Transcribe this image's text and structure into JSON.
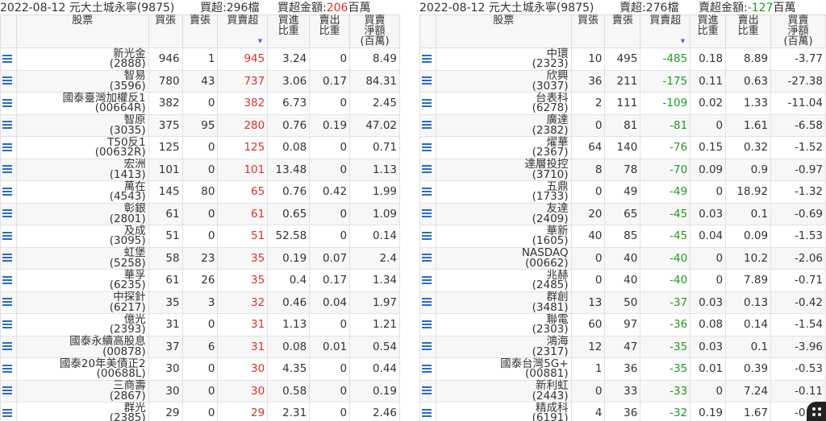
{
  "left": {
    "header": {
      "date_broker": "2022-08-12 元大土城永寧(9875)",
      "count_label": "買超:296檔",
      "amount_label": "買超金額:",
      "amount_value": "206",
      "amount_unit": "百萬"
    },
    "columns": [
      "股票",
      "買張",
      "賣張",
      "買賣超",
      "買進\n比重",
      "賣出\n比重",
      "買賣\n淨額\n(百萬)"
    ],
    "rows": [
      {
        "name": "新光金",
        "code": "(2888)",
        "buy": "946",
        "sell": "1",
        "net": "945",
        "buy_pct": "3.24",
        "sell_pct": "0",
        "amount": "8.49"
      },
      {
        "name": "智易",
        "code": "(3596)",
        "buy": "780",
        "sell": "43",
        "net": "737",
        "buy_pct": "3.06",
        "sell_pct": "0.17",
        "amount": "84.31"
      },
      {
        "name": "國泰臺灣加權反1",
        "code": "(00664R)",
        "buy": "382",
        "sell": "0",
        "net": "382",
        "buy_pct": "6.73",
        "sell_pct": "0",
        "amount": "2.45"
      },
      {
        "name": "智原",
        "code": "(3035)",
        "buy": "375",
        "sell": "95",
        "net": "280",
        "buy_pct": "0.76",
        "sell_pct": "0.19",
        "amount": "47.02"
      },
      {
        "name": "T50反1",
        "code": "(00632R)",
        "buy": "125",
        "sell": "0",
        "net": "125",
        "buy_pct": "0.08",
        "sell_pct": "0",
        "amount": "0.71"
      },
      {
        "name": "宏洲",
        "code": "(1413)",
        "buy": "101",
        "sell": "0",
        "net": "101",
        "buy_pct": "13.48",
        "sell_pct": "0",
        "amount": "1.13"
      },
      {
        "name": "萬在",
        "code": "(4543)",
        "buy": "145",
        "sell": "80",
        "net": "65",
        "buy_pct": "0.76",
        "sell_pct": "0.42",
        "amount": "1.99"
      },
      {
        "name": "彰銀",
        "code": "(2801)",
        "buy": "61",
        "sell": "0",
        "net": "61",
        "buy_pct": "0.65",
        "sell_pct": "0",
        "amount": "1.09"
      },
      {
        "name": "及成",
        "code": "(3095)",
        "buy": "51",
        "sell": "0",
        "net": "51",
        "buy_pct": "52.58",
        "sell_pct": "0",
        "amount": "0.14"
      },
      {
        "name": "虹堡",
        "code": "(5258)",
        "buy": "58",
        "sell": "23",
        "net": "35",
        "buy_pct": "0.19",
        "sell_pct": "0.07",
        "amount": "2.4"
      },
      {
        "name": "華孚",
        "code": "(6235)",
        "buy": "61",
        "sell": "26",
        "net": "35",
        "buy_pct": "0.4",
        "sell_pct": "0.17",
        "amount": "1.34"
      },
      {
        "name": "中探針",
        "code": "(6217)",
        "buy": "35",
        "sell": "3",
        "net": "32",
        "buy_pct": "0.46",
        "sell_pct": "0.04",
        "amount": "1.97"
      },
      {
        "name": "億光",
        "code": "(2393)",
        "buy": "31",
        "sell": "0",
        "net": "31",
        "buy_pct": "1.13",
        "sell_pct": "0",
        "amount": "1.21"
      },
      {
        "name": "國泰永續高股息",
        "code": "(00878)",
        "buy": "37",
        "sell": "6",
        "net": "31",
        "buy_pct": "0.08",
        "sell_pct": "0.01",
        "amount": "0.54"
      },
      {
        "name": "國泰20年美債正2",
        "code": "(00688L)",
        "buy": "30",
        "sell": "0",
        "net": "30",
        "buy_pct": "4.35",
        "sell_pct": "0",
        "amount": "0.44"
      },
      {
        "name": "三商壽",
        "code": "(2867)",
        "buy": "30",
        "sell": "0",
        "net": "30",
        "buy_pct": "0.58",
        "sell_pct": "0",
        "amount": "0.19"
      },
      {
        "name": "群光",
        "code": "(2385)",
        "buy": "29",
        "sell": "0",
        "net": "29",
        "buy_pct": "2.31",
        "sell_pct": "0",
        "amount": "2.46"
      }
    ]
  },
  "right": {
    "header": {
      "date_broker": "2022-08-12 元大土城永寧(9875)",
      "count_label": "賣超:276檔",
      "amount_label": "賣超金額:",
      "amount_value": "-127",
      "amount_unit": "百萬"
    },
    "columns": [
      "股票",
      "買張",
      "賣張",
      "買賣超",
      "買進\n比重",
      "賣出\n比重",
      "買賣\n淨額\n(百萬)"
    ],
    "rows": [
      {
        "name": "中環",
        "code": "(2323)",
        "buy": "10",
        "sell": "495",
        "net": "-485",
        "buy_pct": "0.18",
        "sell_pct": "8.89",
        "amount": "-3.77"
      },
      {
        "name": "欣興",
        "code": "(3037)",
        "buy": "36",
        "sell": "211",
        "net": "-175",
        "buy_pct": "0.11",
        "sell_pct": "0.63",
        "amount": "-27.38"
      },
      {
        "name": "台表科",
        "code": "(6278)",
        "buy": "2",
        "sell": "111",
        "net": "-109",
        "buy_pct": "0.02",
        "sell_pct": "1.33",
        "amount": "-11.04"
      },
      {
        "name": "廣達",
        "code": "(2382)",
        "buy": "0",
        "sell": "81",
        "net": "-81",
        "buy_pct": "0",
        "sell_pct": "1.61",
        "amount": "-6.58"
      },
      {
        "name": "燿華",
        "code": "(2367)",
        "buy": "64",
        "sell": "140",
        "net": "-76",
        "buy_pct": "0.15",
        "sell_pct": "0.32",
        "amount": "-1.52"
      },
      {
        "name": "達層投控",
        "code": "(3710)",
        "buy": "8",
        "sell": "78",
        "net": "-70",
        "buy_pct": "0.09",
        "sell_pct": "0.9",
        "amount": "-0.97"
      },
      {
        "name": "五鼎",
        "code": "(1733)",
        "buy": "0",
        "sell": "49",
        "net": "-49",
        "buy_pct": "0",
        "sell_pct": "18.92",
        "amount": "-1.32"
      },
      {
        "name": "友達",
        "code": "(2409)",
        "buy": "20",
        "sell": "65",
        "net": "-45",
        "buy_pct": "0.03",
        "sell_pct": "0.1",
        "amount": "-0.69"
      },
      {
        "name": "華新",
        "code": "(1605)",
        "buy": "40",
        "sell": "85",
        "net": "-45",
        "buy_pct": "0.04",
        "sell_pct": "0.09",
        "amount": "-1.53"
      },
      {
        "name": "NASDAQ",
        "code": "(00662)",
        "buy": "0",
        "sell": "40",
        "net": "-40",
        "buy_pct": "0",
        "sell_pct": "10.2",
        "amount": "-2.06"
      },
      {
        "name": "兆赫",
        "code": "(2485)",
        "buy": "0",
        "sell": "40",
        "net": "-40",
        "buy_pct": "0",
        "sell_pct": "7.89",
        "amount": "-0.71"
      },
      {
        "name": "群創",
        "code": "(3481)",
        "buy": "13",
        "sell": "50",
        "net": "-37",
        "buy_pct": "0.03",
        "sell_pct": "0.13",
        "amount": "-0.42"
      },
      {
        "name": "聯電",
        "code": "(2303)",
        "buy": "60",
        "sell": "97",
        "net": "-36",
        "buy_pct": "0.08",
        "sell_pct": "0.14",
        "amount": "-1.54"
      },
      {
        "name": "鴻海",
        "code": "(2317)",
        "buy": "12",
        "sell": "47",
        "net": "-35",
        "buy_pct": "0.03",
        "sell_pct": "0.1",
        "amount": "-3.96"
      },
      {
        "name": "國泰台灣5G+",
        "code": "(00881)",
        "buy": "1",
        "sell": "36",
        "net": "-35",
        "buy_pct": "0.01",
        "sell_pct": "0.39",
        "amount": "-0.53"
      },
      {
        "name": "新利虹",
        "code": "(2443)",
        "buy": "0",
        "sell": "33",
        "net": "-33",
        "buy_pct": "0",
        "sell_pct": "7.24",
        "amount": "-0.11"
      },
      {
        "name": "精成科",
        "code": "(6191)",
        "buy": "4",
        "sell": "36",
        "net": "-32",
        "buy_pct": "0.19",
        "sell_pct": "1.67",
        "amount": "-0.11"
      }
    ]
  },
  "colors": {
    "positive": "#e0302a",
    "negative": "#1f9a1f",
    "icon": "#2a6ac8",
    "sort_indicator": "#6a5acd"
  },
  "icons": {
    "row_menu": "list-icon",
    "sort": "sort-down-icon",
    "fab": "grid-dots-icon"
  }
}
